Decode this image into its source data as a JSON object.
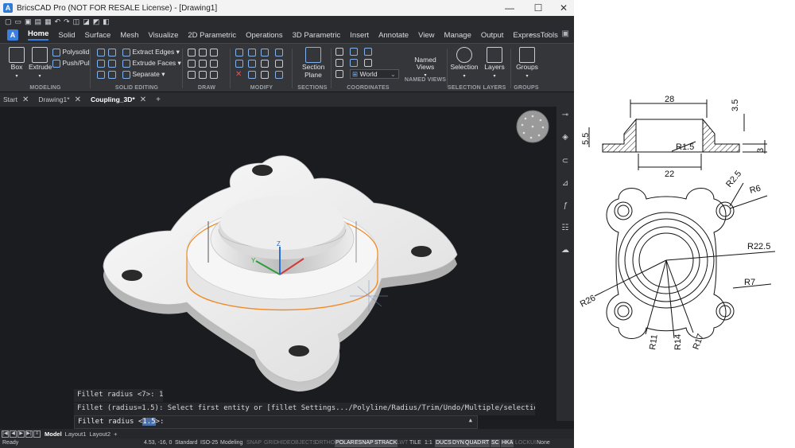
{
  "window": {
    "title": "BricsCAD Pro (NOT FOR RESALE License) - [Drawing1]",
    "controls": [
      "—",
      "☐",
      "✕"
    ]
  },
  "menu": {
    "tabs": [
      "Home",
      "Solid",
      "Surface",
      "Mesh",
      "Visualize",
      "2D Parametric",
      "Operations",
      "3D Parametric",
      "Insert",
      "Annotate",
      "View",
      "Manage",
      "Output",
      "ExpressTools"
    ],
    "active": "Home"
  },
  "ribbon": {
    "modeling": {
      "label": "MODELING",
      "box": "Box",
      "extrude": "Extrude",
      "polysolid": "Polysolid",
      "pushpull": "Push/Pull"
    },
    "solid_editing": {
      "label": "SOLID EDITING",
      "extract_edges": "Extract Edges",
      "extrude_faces": "Extrude Faces",
      "separate": "Separate"
    },
    "draw": {
      "label": "DRAW"
    },
    "modify": {
      "label": "MODIFY"
    },
    "sections": {
      "label": "SECTIONS",
      "section_plane_1": "Section",
      "section_plane_2": "Plane"
    },
    "coordinates": {
      "label": "COORDINATES",
      "world": "World"
    },
    "named_views": {
      "label": "NAMED VIEWS",
      "btn_1": "Named",
      "btn_2": "Views"
    },
    "selection": {
      "label": "SELECTION",
      "btn": "Selection"
    },
    "layers": {
      "label": "LAYERS",
      "btn": "Layers"
    },
    "groups": {
      "label": "GROUPS",
      "btn": "Groups"
    }
  },
  "doc_tabs": [
    "Start",
    "Drawing1*",
    "Coupling_3D*"
  ],
  "active_doc": "Coupling_3D*",
  "command": {
    "history": [
      "Fillet radius <7>: 1.5",
      "Fillet (radius=1.5): Select first entity or [fillet Settings.../Polyline/Radius/Trim/Undo/Multiple/selection options (?)]:"
    ],
    "prompt": "Fillet radius <",
    "prompt_value": "1.5",
    "prompt_end": ">:"
  },
  "layout_tabs": [
    "Model",
    "Layout1",
    "Layout2"
  ],
  "status": {
    "ready": "Ready",
    "coords": "4.53, -16, 0",
    "toggles": [
      "Standard",
      "ISO-25",
      "Modeling",
      "SNAP",
      "GRID",
      "HIDEOBJECTS",
      "ORTHO",
      "POLAR",
      "ESNAP",
      "STRACK",
      "LWT",
      "TILE",
      "1:1",
      "DUCS",
      "DYN",
      "QUAD",
      "RT",
      "SC",
      "HKA",
      "LOCKUI",
      "None"
    ]
  },
  "drawing": {
    "dims": {
      "top_width": "28",
      "top_height": "3.5",
      "left_height": "5.5",
      "fillet": "R1.5",
      "right_height": "3",
      "bottom_width": "22",
      "r_hole_small": "R2.5",
      "r_hole": "R6",
      "r_outer": "R22.5",
      "r_lobe": "R7",
      "r_left": "R26",
      "r_11": "R11",
      "r_14": "R14",
      "r_17": "R17"
    }
  }
}
